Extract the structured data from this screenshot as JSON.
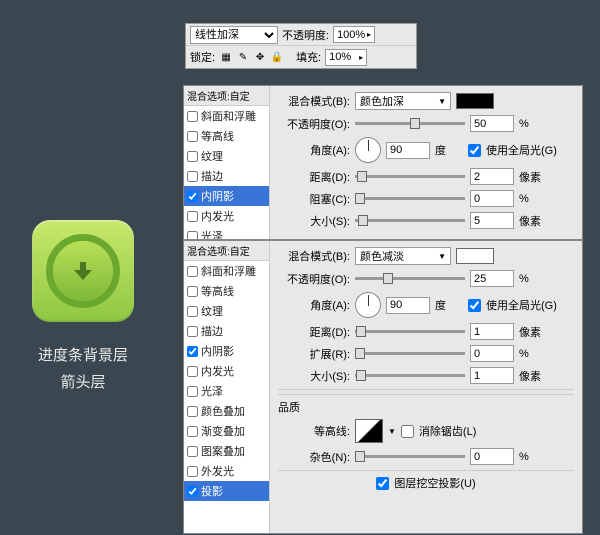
{
  "toolbar": {
    "blend_mode": "线性加深",
    "opacity_label": "不透明度:",
    "opacity_value": "100%",
    "lock_label": "锁定:",
    "fill_label": "填充:",
    "fill_value": "10%"
  },
  "left": {
    "caption1": "进度条背景层",
    "caption2": "箭头层"
  },
  "fx": {
    "header": "混合选项:自定",
    "items": [
      "斜面和浮雕",
      "等高线",
      "纹理",
      "描边",
      "内阴影",
      "内发光",
      "光泽",
      "颜色叠加",
      "渐变叠加",
      "图案叠加",
      "外发光",
      "投影"
    ]
  },
  "panel1": {
    "selected_index": 4,
    "checked": [
      false,
      false,
      false,
      false,
      true,
      false,
      false
    ],
    "blend_label": "混合模式(B):",
    "blend_value": "颜色加深",
    "opacity_label": "不透明度(O):",
    "opacity_value": "50",
    "angle_label": "角度(A):",
    "angle_value": "90",
    "angle_unit": "度",
    "global_light": "使用全局光(G)",
    "global_checked": true,
    "distance_label": "距离(D):",
    "distance_value": "2",
    "distance_unit": "像素",
    "choke_label": "阻塞(C):",
    "choke_value": "0",
    "size_label": "大小(S):",
    "size_value": "5",
    "size_unit": "像素",
    "pct": "%"
  },
  "panel2": {
    "selected_index": 11,
    "checked": [
      false,
      false,
      false,
      false,
      true,
      false,
      false,
      false,
      false,
      false,
      false,
      true
    ],
    "blend_label": "混合模式(B):",
    "blend_value": "颜色减淡",
    "opacity_label": "不透明度(O):",
    "opacity_value": "25",
    "angle_label": "角度(A):",
    "angle_value": "90",
    "angle_unit": "度",
    "global_light": "使用全局光(G)",
    "global_checked": true,
    "distance_label": "距离(D):",
    "distance_value": "1",
    "distance_unit": "像素",
    "spread_label": "扩展(R):",
    "spread_value": "0",
    "size_label": "大小(S):",
    "size_value": "1",
    "size_unit": "像素",
    "quality_label": "品质",
    "contour_label": "等高线:",
    "antialias": "消除锯齿(L)",
    "noise_label": "杂色(N):",
    "noise_value": "0",
    "knockout": "图层挖空投影(U)",
    "knockout_checked": true,
    "pct": "%"
  }
}
